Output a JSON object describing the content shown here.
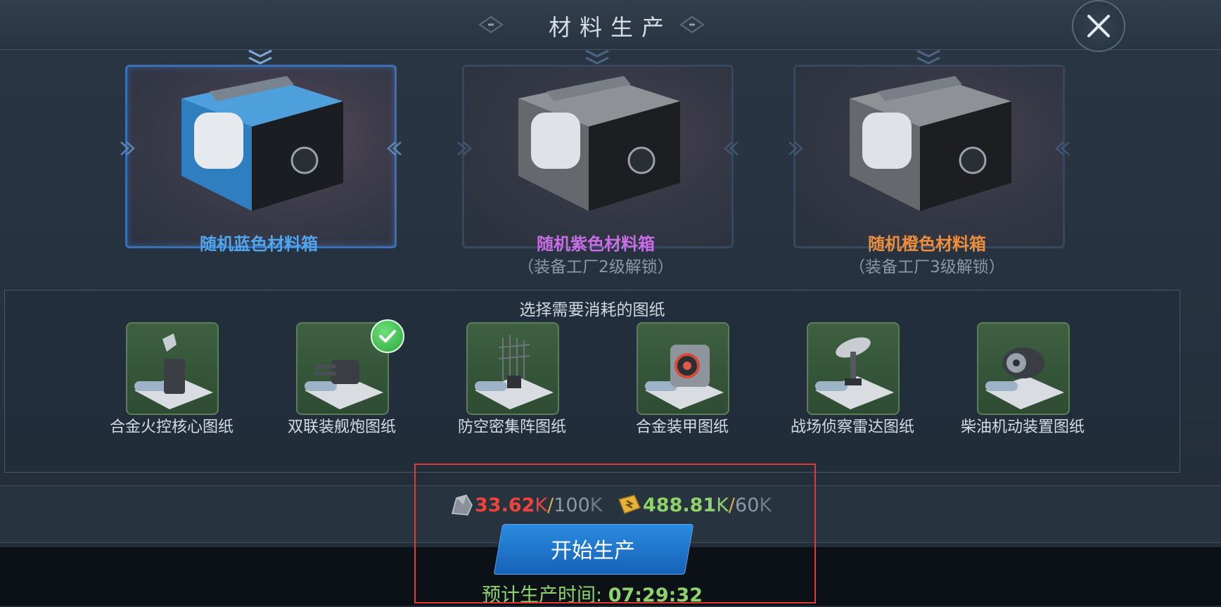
{
  "header": {
    "title": "材料生产"
  },
  "boxes": [
    {
      "name": "随机蓝色材料箱",
      "sublabel": "",
      "color": "#4fa6ee",
      "selected": true
    },
    {
      "name": "随机紫色材料箱",
      "sublabel": "（装备工厂2级解锁）",
      "color": "#c86de6",
      "selected": false
    },
    {
      "name": "随机橙色材料箱",
      "sublabel": "（装备工厂3级解锁）",
      "color": "#ee8e3c",
      "selected": false
    }
  ],
  "blueprints": {
    "title": "选择需要消耗的图纸",
    "items": [
      {
        "name": "合金火控核心图纸",
        "selected": false
      },
      {
        "name": "双联装舰炮图纸",
        "selected": true
      },
      {
        "name": "防空密集阵图纸",
        "selected": false
      },
      {
        "name": "合金装甲图纸",
        "selected": false
      },
      {
        "name": "战场侦察雷达图纸",
        "selected": false
      },
      {
        "name": "柴油机动装置图纸",
        "selected": false
      }
    ]
  },
  "resources": {
    "ore": {
      "icon": "ore-icon",
      "amount": "33.62",
      "amount_unit": "K",
      "sep": "/",
      "required": "100",
      "required_unit": "K",
      "amount_color": "#f0423b"
    },
    "fuel": {
      "icon": "fuel-icon",
      "amount": "488.81",
      "amount_unit": "K",
      "sep": "/",
      "required": "60",
      "required_unit": "K",
      "amount_color": "#8ed36a"
    }
  },
  "action": {
    "start_label": "开始生产"
  },
  "eta": {
    "label": "预计生产时间:",
    "time": "07:29:32"
  }
}
